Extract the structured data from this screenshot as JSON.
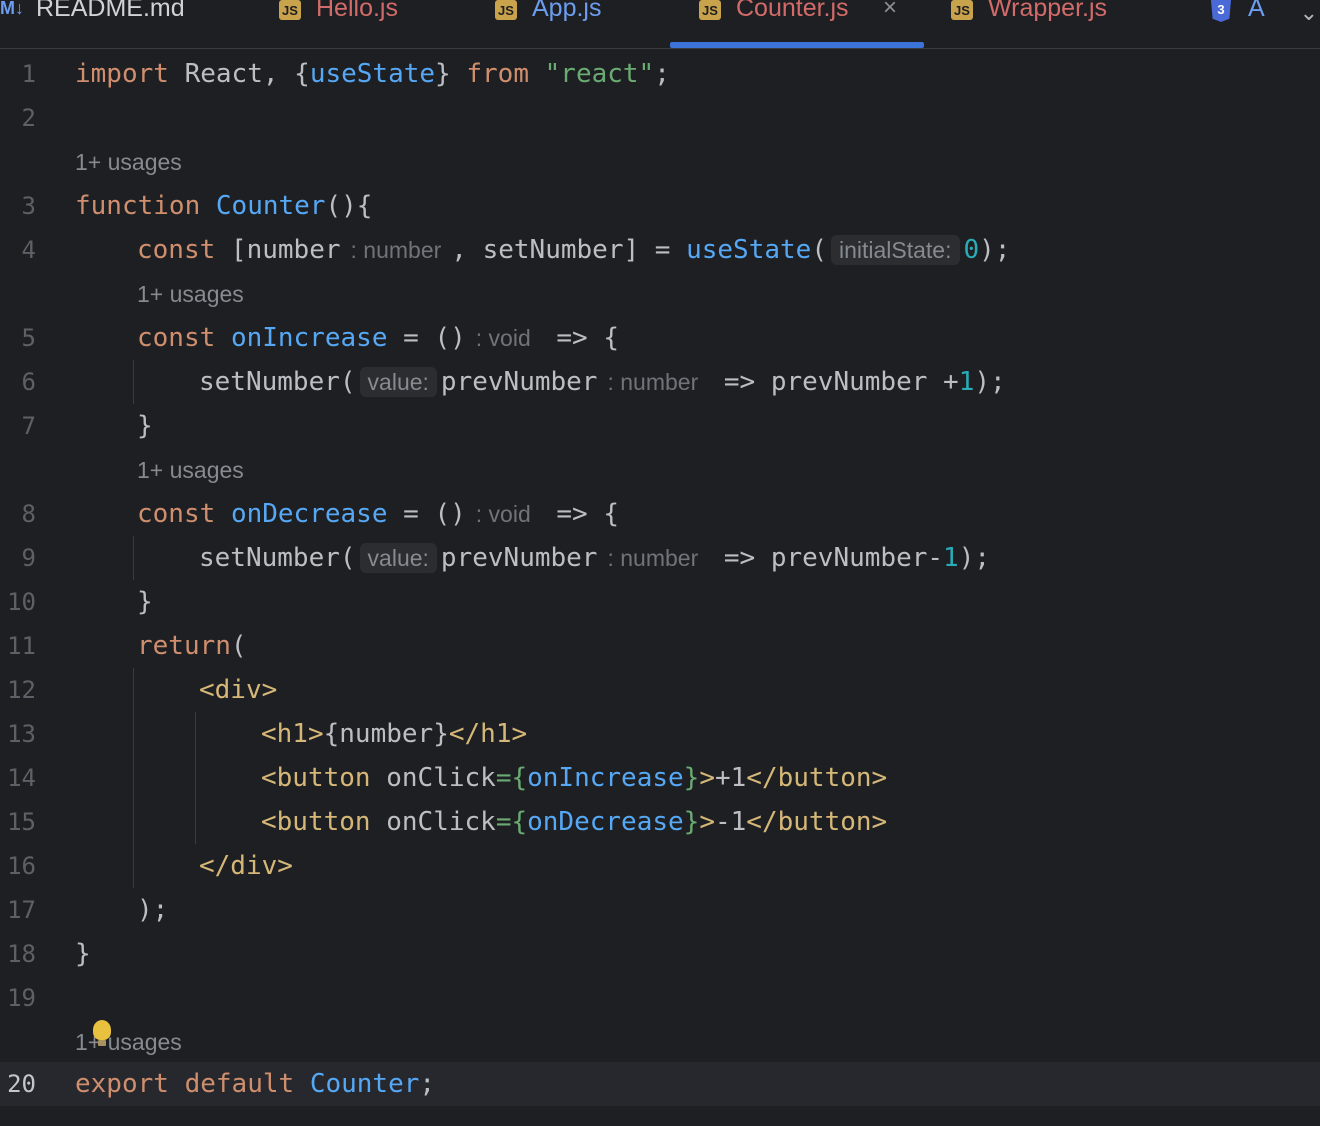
{
  "tabs": [
    {
      "label": "README.md",
      "icon": "markdown-icon",
      "icon_text": "M↓"
    },
    {
      "label": "Hello.js",
      "icon": "js-file-icon",
      "icon_text": "JS"
    },
    {
      "label": "App.js",
      "icon": "js-file-icon",
      "icon_text": "JS"
    },
    {
      "label": "Counter.js",
      "icon": "js-file-icon",
      "icon_text": "JS",
      "active": true,
      "close": "×"
    },
    {
      "label": "Wrapper.js",
      "icon": "js-file-icon",
      "icon_text": "JS"
    },
    {
      "label": "A",
      "icon": "css-file-icon",
      "icon_text": "3"
    }
  ],
  "tab_overflow_icon": "chevron-down-icon",
  "tab_overflow_glyph": "⌄",
  "usages_hint": "1+ usages",
  "line_numbers": [
    "1",
    "2",
    "3",
    "4",
    "5",
    "6",
    "7",
    "8",
    "9",
    "10",
    "11",
    "12",
    "13",
    "14",
    "15",
    "16",
    "17",
    "18",
    "19",
    "20"
  ],
  "current_line": "20",
  "code": {
    "l1": {
      "import": "import",
      "react": " React, {",
      "usestate": "useState",
      "close": "} ",
      "from": "from",
      "sp": " ",
      "module": "\"react\"",
      "semi": ";"
    },
    "l3": {
      "function": "function",
      "name": "Counter",
      "rest": "(){"
    },
    "l4": {
      "const": "const",
      "open": " [number",
      "type": ": number",
      "mid": ", setNumber] = ",
      "usestate": "useState",
      "paren": "(",
      "param": "initialState:",
      "zero": "0",
      "end": ");"
    },
    "l5": {
      "const": "const",
      "name": "onIncrease",
      "eq": " = ()",
      "type": ": void",
      "arrow": " => {"
    },
    "l6": {
      "call": "setNumber(",
      "param": "value:",
      "arg": "prevNumber",
      "type": ": number",
      "arrow": " => prevNumber +",
      "one": "1",
      "end": ");"
    },
    "l7": {
      "brace": "}"
    },
    "l8": {
      "const": "const",
      "name": "onDecrease",
      "eq": " = ()",
      "type": ": void",
      "arrow": " => {"
    },
    "l9": {
      "call": "setNumber(",
      "param": "value:",
      "arg": "prevNumber",
      "type": ": number",
      "arrow": " => prevNumber-",
      "one": "1",
      "end": ");"
    },
    "l10": {
      "brace": "}"
    },
    "l11": {
      "ret": "return",
      "paren": "("
    },
    "l12": {
      "tag": "<div>"
    },
    "l13": {
      "open": "<h1>",
      "expr": "{number}",
      "close": "</h1>"
    },
    "l14": {
      "open": "<button",
      "attr": " onClick",
      "eq": "=",
      "b1": "{",
      "handler": "onIncrease",
      "b2": "}",
      "gt": ">",
      "text": "+1",
      "close": "</button>"
    },
    "l15": {
      "open": "<button",
      "attr": " onClick",
      "eq": "=",
      "b1": "{",
      "handler": "onDecrease",
      "b2": "}",
      "gt": ">",
      "text": "-1",
      "close": "</button>"
    },
    "l16": {
      "tag": "</div>"
    },
    "l17": {
      "text": ");"
    },
    "l18": {
      "text": "}"
    },
    "l20": {
      "export": "export",
      "sp": " ",
      "default": "default",
      "sp2": " ",
      "name": "Counter",
      "semi": ";"
    }
  },
  "colors": {
    "background": "#1e1f22",
    "keyword": "#cf8e6d",
    "function": "#56a8f5",
    "string": "#6aab73",
    "number": "#2aacb8",
    "jsx_tag": "#d5b778",
    "active_tab_underline": "#3b73d9"
  }
}
